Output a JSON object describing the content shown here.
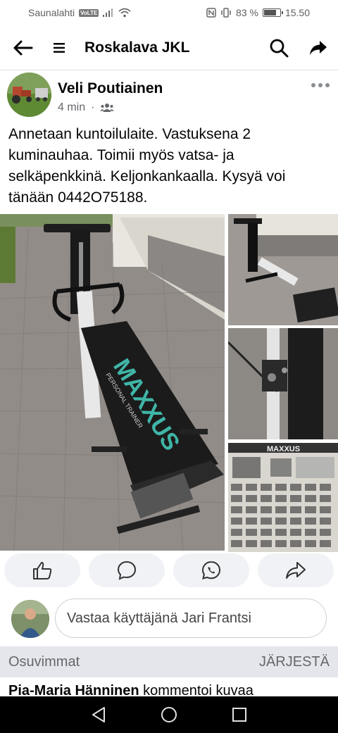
{
  "status_bar": {
    "carrier": "Saunalahti",
    "volte": "VoLTE",
    "battery": "83 %",
    "battery_level": 0.83,
    "time": "15.50"
  },
  "header": {
    "title": "Roskalava JKL",
    "back_icon": "arrow-left-icon",
    "menu_icon": "hamburger-icon",
    "search_icon": "search-icon",
    "share_icon": "share-arrow-icon"
  },
  "post": {
    "author": "Veli Poutiainen",
    "time_ago": "4 min",
    "separator": "·",
    "audience_icon": "group-icon",
    "text": "Annetaan kuntoilulaite. Vastuksena 2 kuminauhaa. Toimii myös vatsa- ja selkäpenkkinä. Keljonkankaalla. Kysyä voi tänään  0442O75188.",
    "photos": {
      "bench_brand": "MAXXUS",
      "bench_subtitle": "PERSONAL TRAINER",
      "poster_brand": "MAXXUS"
    }
  },
  "actions": {
    "like_icon": "thumbs-up-icon",
    "comment_icon": "comment-bubble-icon",
    "whatsapp_icon": "whatsapp-icon",
    "share_icon": "share-icon"
  },
  "comment_box": {
    "placeholder": "Vastaa käyttäjänä Jari Frantsi"
  },
  "comments_header": {
    "sort_label": "Osuvimmat",
    "sort_action": "JÄRJESTÄ"
  },
  "first_comment": {
    "author": "Pia-Maria Hänninen",
    "action": " kommentoi kuvaa"
  },
  "colors": {
    "accent": "#1877f2",
    "text": "#050505",
    "secondary": "#65676b",
    "surface": "#f0f2f5"
  }
}
